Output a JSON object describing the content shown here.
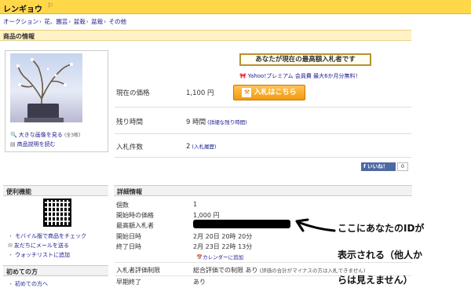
{
  "header": {
    "title": "レンギョウ",
    "title_icon": "⚐"
  },
  "breadcrumb": [
    "オークション",
    "花、園芸",
    "盆栽",
    "盆栽",
    "その他"
  ],
  "sections": {
    "item_info": "商品の情報",
    "convenience": "便利機能",
    "details": "詳細情報",
    "beginners": "初めての方"
  },
  "image_panel": {
    "enlarge_link": "大きな画像を見る",
    "enlarge_count": "(全3枚)",
    "description_link": "商品説明を読む"
  },
  "status": {
    "winner_badge": "あなたが現在の最高額入札者です",
    "premium_text": "Yahoo!プレミアム 会員費 最大6か月分無料！"
  },
  "summary": [
    {
      "label": "現在の価格",
      "value": "1,100 円",
      "extra": ""
    },
    {
      "label": "残り時間",
      "value": "9 時間",
      "extra": "(詳細な残り時間)"
    },
    {
      "label": "入札件数",
      "value": "2",
      "extra": "(入札履歴)"
    }
  ],
  "bid_button_label": "入札はこちら",
  "like": {
    "label": "いいね！",
    "count": "0"
  },
  "sidebar_links": [
    "モバイル版で商品をチェック",
    "友だちにメールを送る",
    "ウォッチリストに追加",
    "初めての方へ"
  ],
  "details": [
    {
      "label": "個数",
      "value": "1"
    },
    {
      "label": "開始時の価格",
      "value": "1,000 円"
    },
    {
      "label": "最高額入札者",
      "value": ""
    },
    {
      "label": "開始日時",
      "value": "2月 20日 20時 20分"
    },
    {
      "label": "終了日時",
      "value": "2月 23日 22時 13分"
    },
    {
      "label": "",
      "value": "カレンダーに追加"
    },
    {
      "label": "入札者評価制限",
      "value": "総合評価での制限 あり",
      "extra": "(評価の合計がマイナスの方は入札できません)"
    },
    {
      "label": "早期終了",
      "value": "あり"
    }
  ],
  "annotation": [
    "ここにあなたのIDが",
    "表示される（他人か",
    "らは見えません）"
  ],
  "colors": {
    "header_bg": "#ffd84a",
    "accent_orange": "#f39a0e",
    "link": "#1a1a8c"
  }
}
